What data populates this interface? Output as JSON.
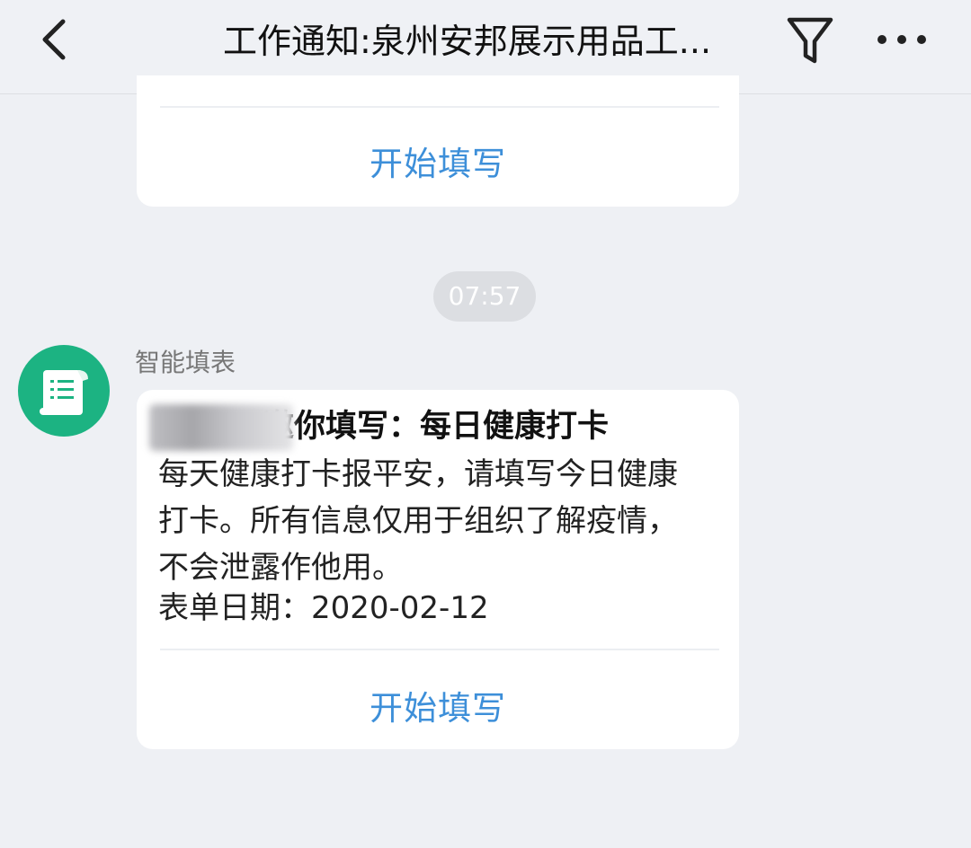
{
  "header": {
    "title": "工作通知:泉州安邦展示用品工..."
  },
  "top_card": {
    "button_label": "开始填写"
  },
  "timestamp": "07:57",
  "message": {
    "sender": "智能填表",
    "title": "邀你填写：每日健康打卡",
    "body": "每天健康打卡报平安，请填写今日健康打卡。所有信息仅用于组织了解疫情，不会泄露作他用。",
    "date_label": "表单日期：",
    "date_value": "2020-02-12",
    "button_label": "开始填写"
  },
  "colors": {
    "accent": "#3d8fd9",
    "avatar_bg": "#1cb382",
    "background": "#eef0f4"
  },
  "icons": {
    "back": "chevron-left-icon",
    "filter": "filter-icon",
    "more": "more-icon",
    "avatar": "form-document-icon"
  }
}
